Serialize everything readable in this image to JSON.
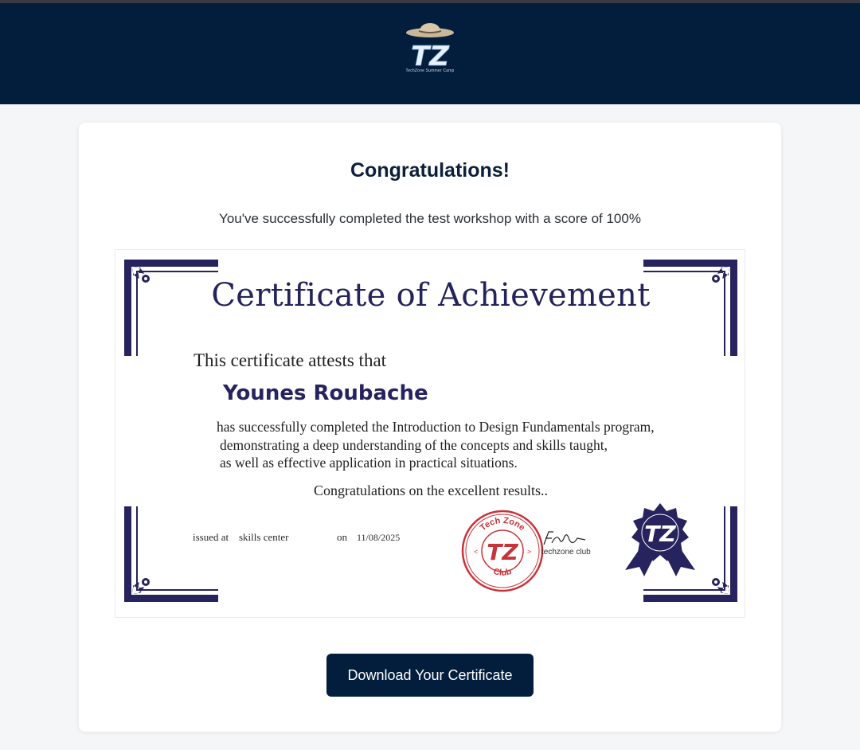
{
  "header": {
    "logo_text": "TZ",
    "logo_caption": "TechZone Summer Camp",
    "background": "#031e3d"
  },
  "main": {
    "title": "Congratulations!",
    "subtitle": "You've successfully completed the test workshop with a score of 100%"
  },
  "certificate": {
    "heading": "Certificate of  Achievement",
    "attests": "This certificate attests that",
    "recipient": "Younes Roubache",
    "body_lines": [
      "has successfully completed the Introduction to Design Fundamentals program,",
      "demonstrating a deep understanding of the concepts and skills taught,",
      "as well as effective application in practical situations."
    ],
    "congrats": "Congratulations on the excellent results..",
    "issued_label": "issued at",
    "issued_value": "skills center",
    "on_label": "on",
    "date": "11/08/2025",
    "stamp_top": "Tech Zone",
    "stamp_bottom": "Club",
    "stamp_logo": "TZ",
    "club_label": "techzone club",
    "seal_logo": "TZ",
    "frame_color": "#26235e",
    "stamp_color": "#c8333a"
  },
  "actions": {
    "download_label": "Download Your Certificate"
  }
}
